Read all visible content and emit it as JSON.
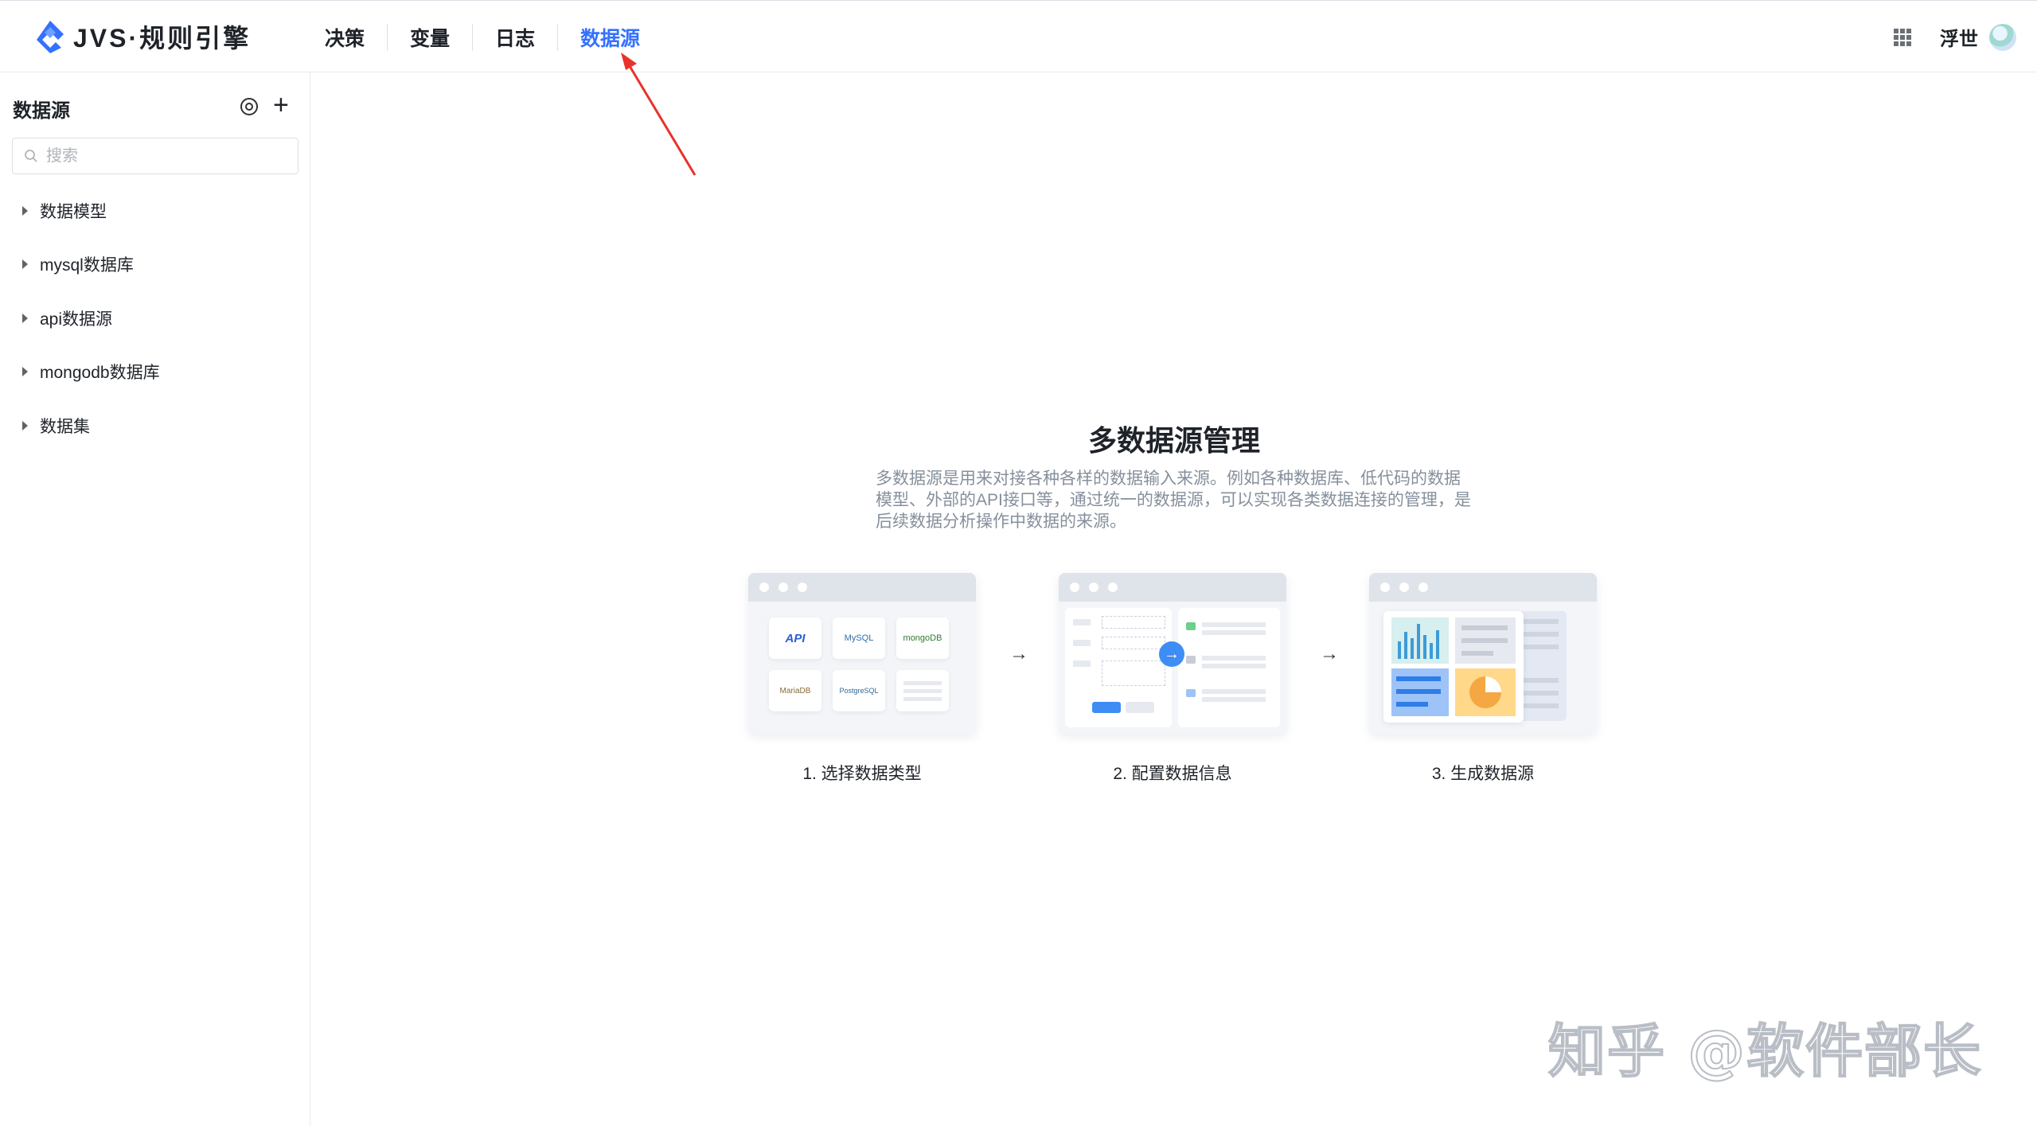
{
  "app": {
    "title": "JVS·规则引擎",
    "brand_color": "#3471ff"
  },
  "nav": {
    "items": [
      {
        "label": "决策",
        "active": false
      },
      {
        "label": "变量",
        "active": false
      },
      {
        "label": "日志",
        "active": false
      },
      {
        "label": "数据源",
        "active": true
      }
    ]
  },
  "user": {
    "name": "浮世",
    "apps_icon": "grid-apps-icon"
  },
  "sidebar": {
    "title": "数据源",
    "settings_icon": "settings-icon",
    "add_icon": "plus-icon",
    "search": {
      "placeholder": "搜索",
      "value": ""
    },
    "tree": [
      {
        "label": "数据模型"
      },
      {
        "label": "mysql数据库"
      },
      {
        "label": "api数据源"
      },
      {
        "label": "mongodb数据库"
      },
      {
        "label": "数据集"
      }
    ]
  },
  "main": {
    "title": "多数据源管理",
    "desc_lines": [
      "多数据源是用来对接各种各样的数据输入来源。例如各种数据库、低代码的数据",
      "模型、外部的API接口等，通过统一的数据源，可以实现各类数据连接的管理，是",
      "后续数据分析操作中数据的来源。"
    ],
    "steps": [
      {
        "label": "1. 选择数据类型",
        "tiles": [
          "API",
          "MySQL",
          "mongoDB",
          "MariaDB",
          "PostgreSQL"
        ]
      },
      {
        "label": "2. 配置数据信息"
      },
      {
        "label": "3. 生成数据源"
      }
    ],
    "step_arrow": "→"
  },
  "watermark": "知乎 @软件部长"
}
